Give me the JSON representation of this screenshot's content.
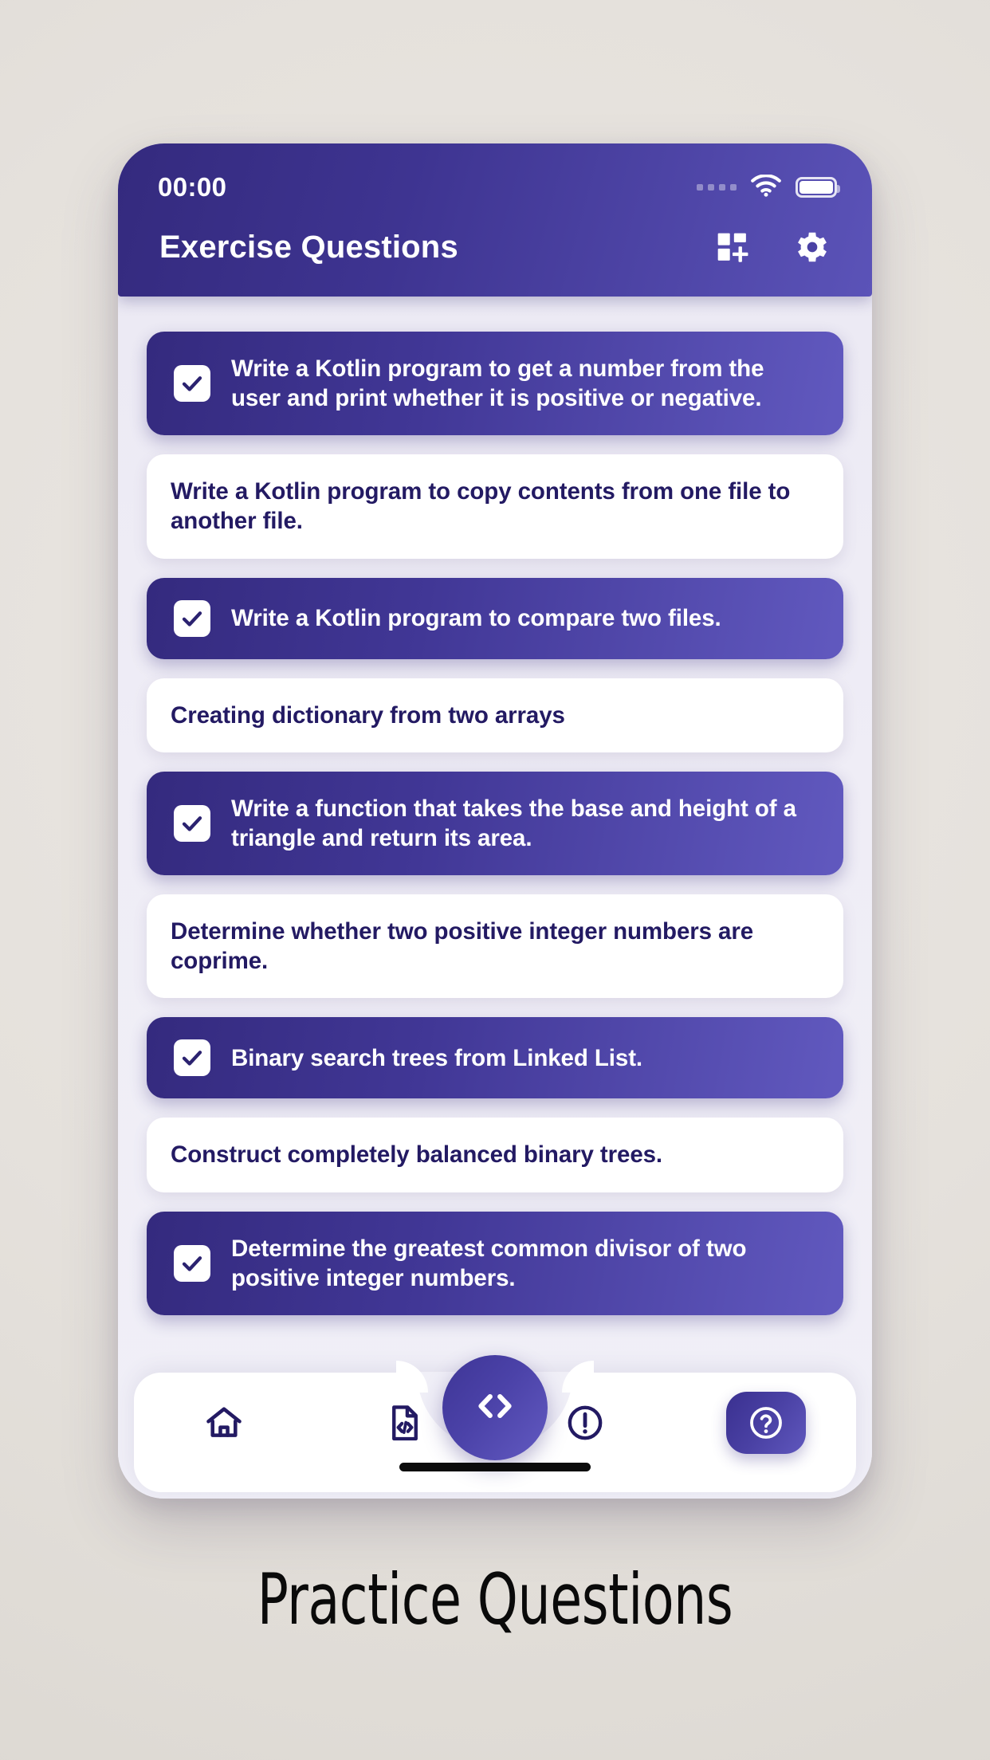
{
  "caption": "Practice Questions",
  "phone": {
    "statusbar": {
      "time": "00:00",
      "icons": [
        "signal-dots",
        "wifi-icon",
        "battery-icon"
      ]
    },
    "header": {
      "title": "Exercise Questions",
      "actions": [
        {
          "name": "add-widget-icon",
          "label": "Add"
        },
        {
          "name": "gear-icon",
          "label": "Settings"
        }
      ],
      "gradient_from": "#342a7e",
      "gradient_to": "#5b53b8"
    },
    "questions": [
      {
        "text": "Write a Kotlin program to get a number from the user and print whether it is positive or negative.",
        "done": true
      },
      {
        "text": "Write a Kotlin  program to copy contents from one file to another file.",
        "done": false
      },
      {
        "text": "Write a Kotlin program to compare two files.",
        "done": true
      },
      {
        "text": "Creating dictionary from two arrays",
        "done": false
      },
      {
        "text": "Write a function that takes the base and height of a triangle and return its area.",
        "done": true
      },
      {
        "text": "Determine whether two positive integer numbers are coprime.",
        "done": false
      },
      {
        "text": "Binary search trees from Linked List.",
        "done": true
      },
      {
        "text": "Construct completely balanced binary trees.",
        "done": false
      },
      {
        "text": "Determine the greatest common divisor of two positive integer numbers.",
        "done": true
      }
    ],
    "fab": {
      "name": "code-brackets-icon",
      "label": "Code"
    },
    "bottom_nav": [
      {
        "name": "home-icon",
        "label": "Home",
        "active": false
      },
      {
        "name": "code-file-icon",
        "label": "Programs",
        "active": false
      },
      {
        "name": "alert-circle-icon",
        "label": "About",
        "active": false
      },
      {
        "name": "help-circle-icon",
        "label": "Questions",
        "active": true
      }
    ],
    "accent": "#3e3596",
    "card_done_color": "#342a7e",
    "card_text_color": "#231a63"
  }
}
